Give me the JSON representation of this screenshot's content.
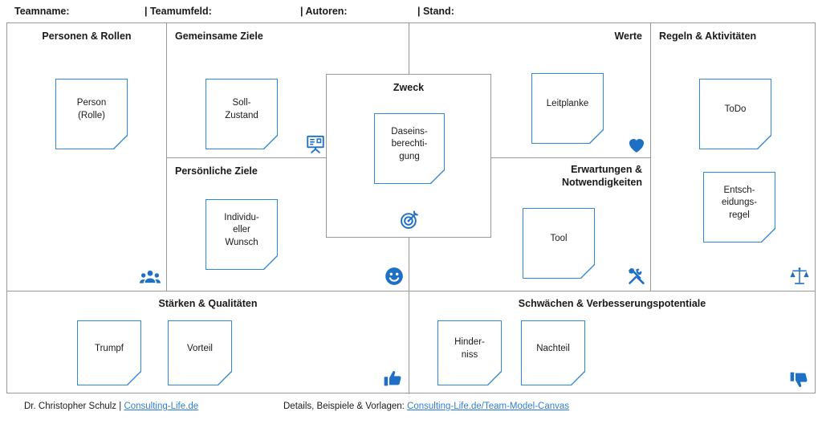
{
  "meta": {
    "teamname_label": "Teamname:",
    "teamumfeld_label": "| Teamumfeld:",
    "autoren_label": "| Autoren:",
    "stand_label": "| Stand:"
  },
  "cells": {
    "personen": {
      "title": "Personen & Rollen",
      "icon": "people-group-icon"
    },
    "gemeinsame_ziele": {
      "title": "Gemeinsame Ziele",
      "icon": "flipchart-icon"
    },
    "persoenliche_ziele": {
      "title": "Persönliche Ziele",
      "icon": "smiley-icon"
    },
    "zweck": {
      "title": "Zweck",
      "icon": "target-icon"
    },
    "werte": {
      "title": "Werte",
      "icon": "heart-icon"
    },
    "erwartungen": {
      "title": "Erwartungen &\nNotwendigkeiten",
      "icon": "tools-icon"
    },
    "regeln": {
      "title": "Regeln & Aktivitäten",
      "icon": "scales-icon"
    },
    "staerken": {
      "title": "Stärken & Qualitäten",
      "icon": "thumbs-up-icon"
    },
    "schwaechen": {
      "title": "Schwächen & Verbesserungspotentiale",
      "icon": "thumbs-down-icon"
    }
  },
  "notes": {
    "person": "Person\n(Rolle)",
    "soll_zustand": "Soll-\nZustand",
    "individueller_wunsch": "Individu-\neller\nWunsch",
    "daseinsberechtigung": "Daseins-\nberechti-\ngung",
    "leitplanke": "Leitplanke",
    "tool": "Tool",
    "todo": "ToDo",
    "entscheidungsregel": "Entsch-\neidungs-\nregel",
    "trumpf": "Trumpf",
    "vorteil": "Vorteil",
    "hinderniss": "Hinder-\nniss",
    "nachteil": "Nachteil"
  },
  "footer": {
    "author": "Dr. Christopher Schulz | ",
    "author_link": "Consulting-Life.de",
    "details_label": "Details, Beispiele & Vorlagen: ",
    "details_link": "Consulting-Life.de/Team-Model-Canvas"
  },
  "colors": {
    "note_border": "#2e8ad8",
    "icon_blue": "#1f6fc4",
    "grid": "#999999",
    "link": "#2f7fd0",
    "text": "#1a1a1a"
  }
}
